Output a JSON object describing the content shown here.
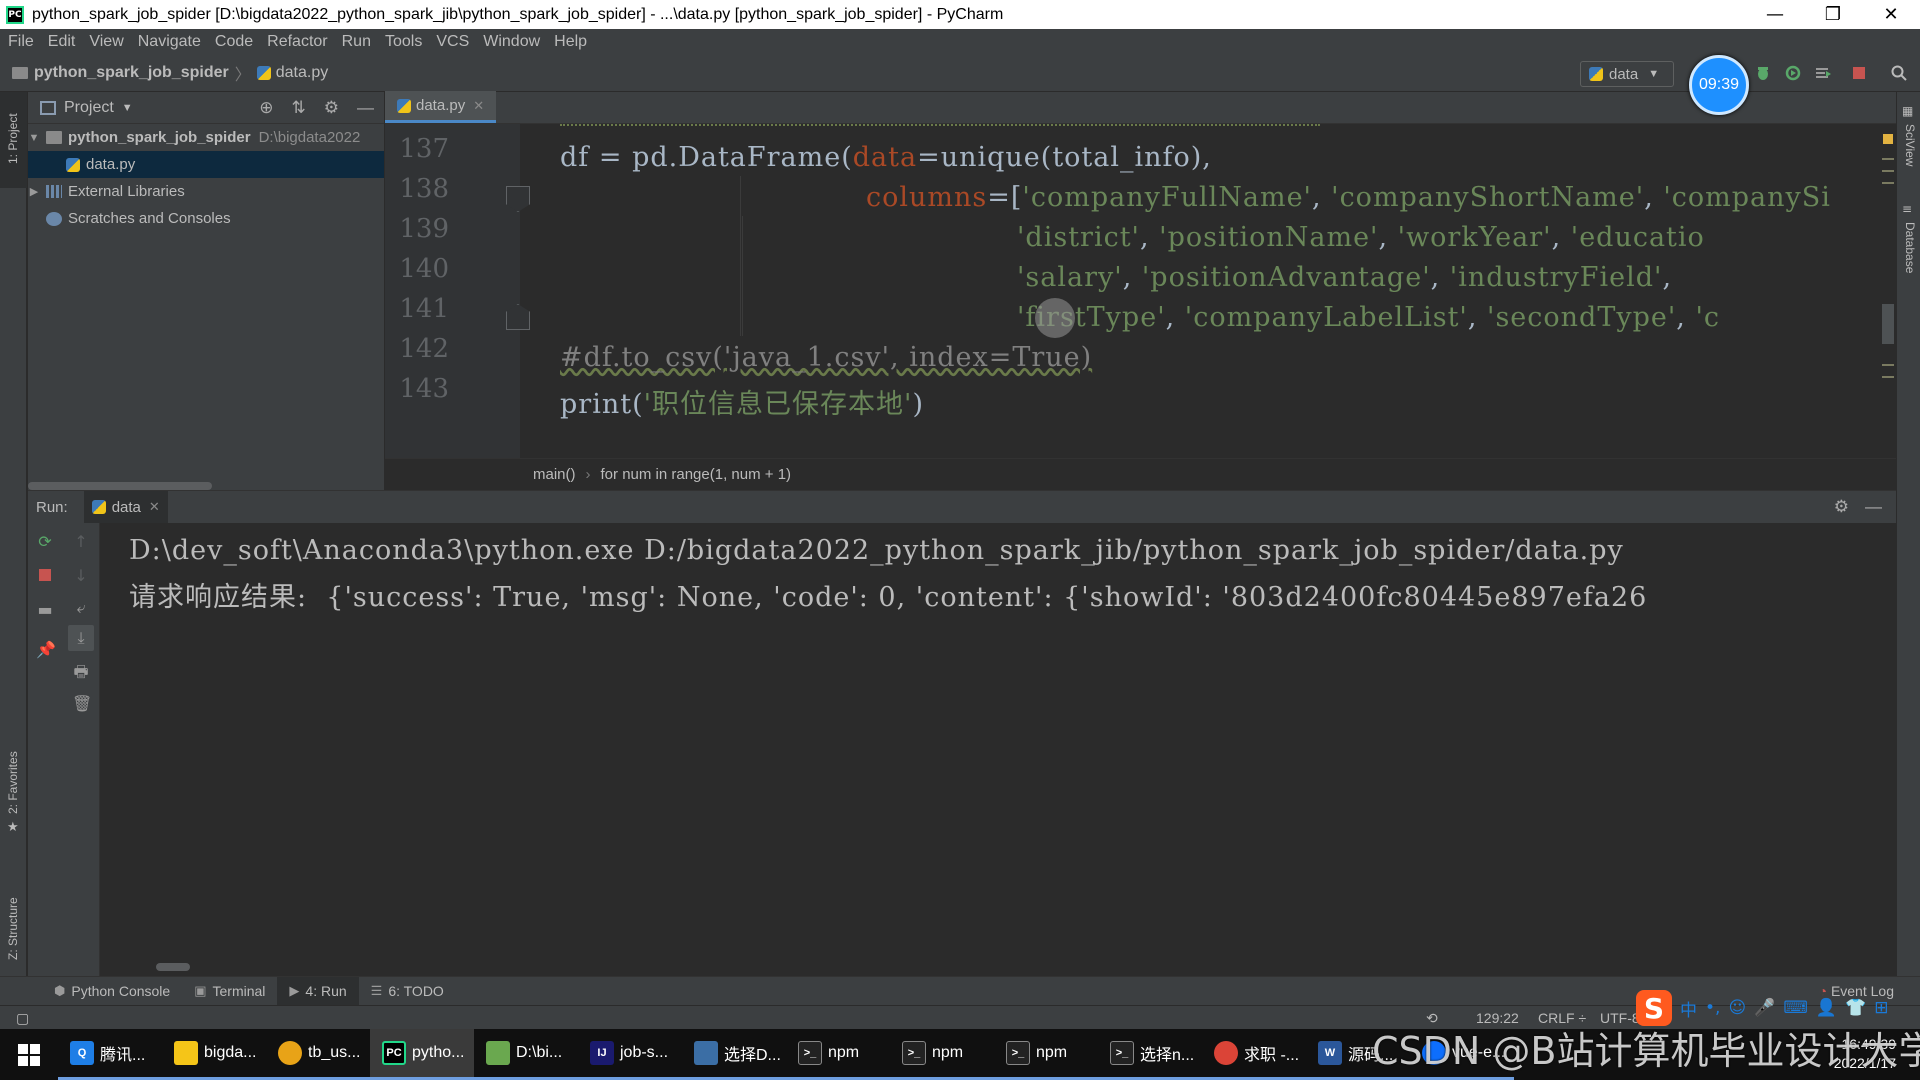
{
  "window": {
    "title": "python_spark_job_spider [D:\\bigdata2022_python_spark_jib\\python_spark_job_spider] - ...\\data.py [python_spark_job_spider] - PyCharm",
    "app_icon_label": "PC",
    "minimize": "—",
    "restore": "❐",
    "close": "✕"
  },
  "menu": [
    "File",
    "Edit",
    "View",
    "Navigate",
    "Code",
    "Refactor",
    "Run",
    "Tools",
    "VCS",
    "Window",
    "Help"
  ],
  "navbar": {
    "project": "python_spark_job_spider",
    "file": "data.py",
    "run_config": "data",
    "timer": "09:39"
  },
  "left_stripe": {
    "project": "1: Project",
    "favorites": "2: Favorites",
    "structure": "Z: Structure"
  },
  "right_stripe": {
    "sciview": "SciView",
    "database": "Database"
  },
  "project_panel": {
    "title": "Project",
    "root_name": "python_spark_job_spider",
    "root_path": "D:\\bigdata2022",
    "file": "data.py",
    "external_libraries": "External Libraries",
    "scratches": "Scratches and Consoles"
  },
  "editor": {
    "tab": "data.py",
    "line_numbers": [
      "137",
      "138",
      "139",
      "140",
      "141",
      "142",
      "143"
    ],
    "lines": {
      "l137_a": "df = pd.DataFrame(",
      "l137_param": "data",
      "l137_b": "=unique(total_info),",
      "l138_param": "columns",
      "l138_a": "=[",
      "l138_s1": "'companyFullName'",
      "l138_c1": ", ",
      "l138_s2": "'companyShortName'",
      "l138_c2": ", ",
      "l138_s3": "'companySi",
      "l139_s1": "'district'",
      "l139_c1": ", ",
      "l139_s2": "'positionName'",
      "l139_c2": ", ",
      "l139_s3": "'workYear'",
      "l139_c3": ", ",
      "l139_s4": "'educatio",
      "l140_s1": "'salary'",
      "l140_c1": ", ",
      "l140_s2": "'positionAdvantage'",
      "l140_c2": ", ",
      "l140_s3": "'industryField'",
      "l140_c3": ",",
      "l141_s1": "'firstType'",
      "l141_c1": ", ",
      "l141_s2": "'companyLabelList'",
      "l141_c2": ", ",
      "l141_s3": "'secondType'",
      "l141_c3": ", ",
      "l141_s4": "'c",
      "l142": "#df.to_csv('java_1.csv', index=True)",
      "l143_a": "print(",
      "l143_s": "'职位信息已保存本地'",
      "l143_b": ")"
    },
    "breadcrumb": [
      "main()",
      "for num in range(1, num + 1)"
    ]
  },
  "run_panel": {
    "label": "Run:",
    "tab": "data",
    "output": [
      "D:\\dev_soft\\Anaconda3\\python.exe D:/bigdata2022_python_spark_jib/python_spark_job_spider/data.py",
      "请求响应结果:  {'success': True, 'msg': None, 'code': 0, 'content': {'showId': '803d2400fc80445e897efa26"
    ]
  },
  "tool_tabs": [
    {
      "icon": "python-console-icon",
      "label": "Python Console"
    },
    {
      "icon": "terminal-icon",
      "label": "Terminal"
    },
    {
      "icon": "run-icon",
      "label": "4: Run"
    },
    {
      "icon": "todo-icon",
      "label": "6: TODO"
    }
  ],
  "event_log": "Event Log",
  "status": {
    "position": "129:22",
    "line_sep": "CRLF ÷",
    "encoding": "UTF-8"
  },
  "ime": {
    "logo": "S",
    "items": [
      "中",
      "•,",
      "☺",
      "🎤",
      "⌨",
      "👤",
      "👕",
      "⊞"
    ]
  },
  "taskbar": {
    "items": [
      {
        "label": "腾讯...",
        "color": "#1e7ee6",
        "glyph": "Q"
      },
      {
        "label": "bigda...",
        "color": "#f5c518",
        "glyph": ""
      },
      {
        "label": "tb_us...",
        "color": "#e8a317",
        "glyph": ""
      },
      {
        "label": "pytho...",
        "color": "#000000",
        "glyph": "PC"
      },
      {
        "label": "D:\\bi...",
        "color": "#6aa84f",
        "glyph": ""
      },
      {
        "label": "job-s...",
        "color": "#1a1a6e",
        "glyph": "IJ"
      },
      {
        "label": "选择D...",
        "color": "#3b6ea5",
        "glyph": ""
      },
      {
        "label": "npm",
        "color": "#222222",
        "glyph": ">_"
      },
      {
        "label": "npm",
        "color": "#222222",
        "glyph": ">_"
      },
      {
        "label": "npm",
        "color": "#222222",
        "glyph": ">_"
      },
      {
        "label": "选择n...",
        "color": "#222222",
        "glyph": ">_"
      },
      {
        "label": "求职 -...",
        "color": "#db4437",
        "glyph": ""
      },
      {
        "label": "源码...",
        "color": "#2b579a",
        "glyph": "W"
      },
      {
        "label": "vue-e...",
        "color": "#0d6efd",
        "glyph": ""
      }
    ],
    "time": "16:49:39",
    "date": "2022/1/17"
  },
  "watermark": "CSDN @B站计算机毕业设计大学"
}
